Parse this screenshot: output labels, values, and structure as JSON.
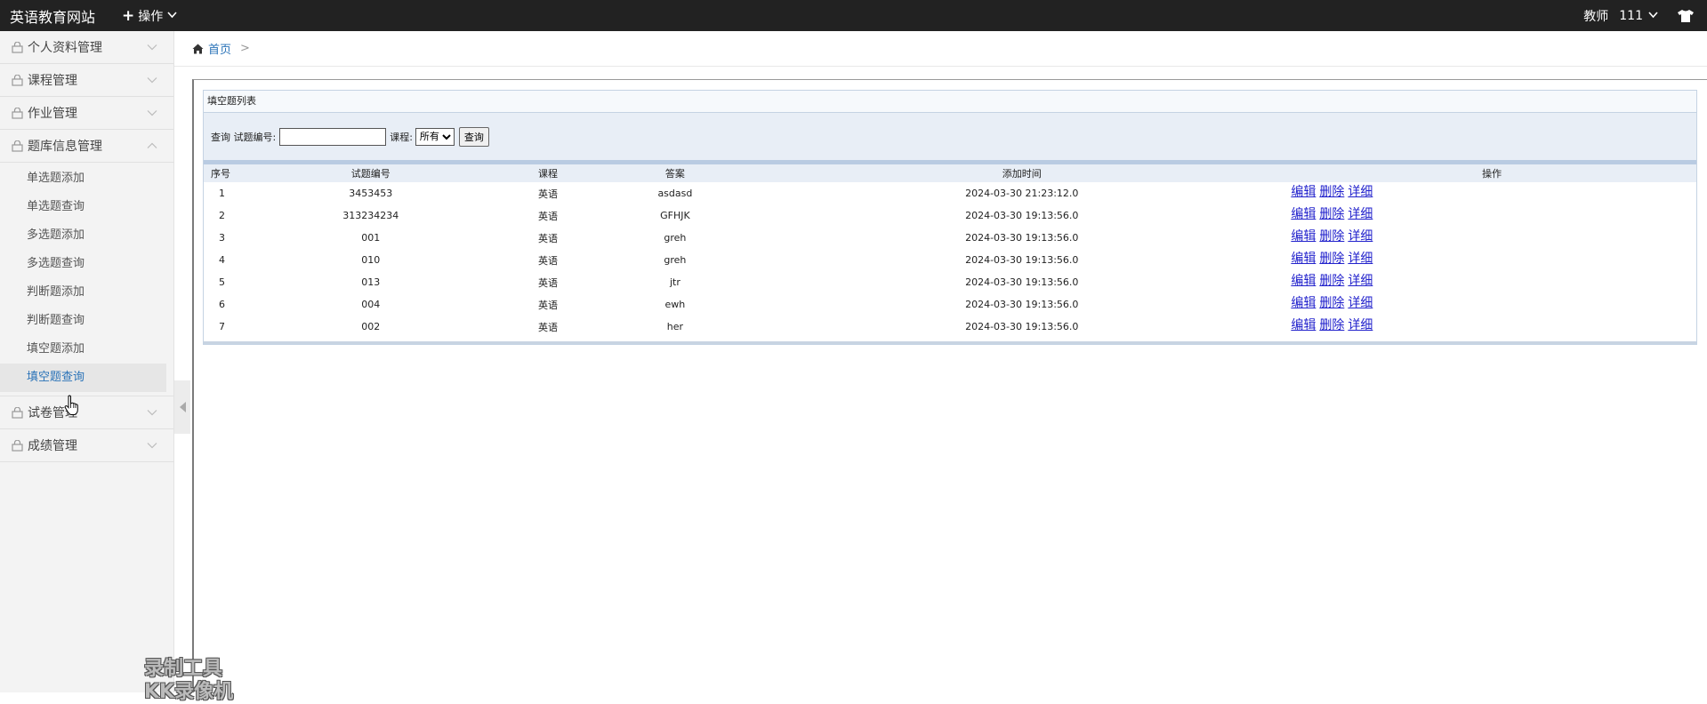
{
  "header": {
    "brand": "英语教育网站",
    "ops_label": "操作",
    "role": "教师",
    "username": "111"
  },
  "sidebar": {
    "groups": [
      {
        "label": "个人资料管理"
      },
      {
        "label": "课程管理"
      },
      {
        "label": "作业管理"
      },
      {
        "label": "题库信息管理"
      },
      {
        "label": "试卷管理"
      },
      {
        "label": "成绩管理"
      }
    ],
    "subitems": [
      "单选题添加",
      "单选题查询",
      "多选题添加",
      "多选题查询",
      "判断题添加",
      "判断题查询",
      "填空题添加",
      "填空题查询"
    ]
  },
  "breadcrumb": {
    "home": "首页",
    "sep": ">"
  },
  "panel": {
    "title": "填空题列表",
    "query_label": "查询 试题编号:",
    "course_label": "课程:",
    "course_selected": "所有",
    "search_button": "查询",
    "search_value": ""
  },
  "table": {
    "headers": [
      "序号",
      "试题编号",
      "课程",
      "答案",
      "添加时间",
      "操作"
    ],
    "rows": [
      {
        "idx": "1",
        "code": "3453453",
        "course": "英语",
        "answer": "asdasd",
        "time": "2024-03-30 21:23:12.0"
      },
      {
        "idx": "2",
        "code": "313234234",
        "course": "英语",
        "answer": "GFHJK",
        "time": "2024-03-30 19:13:56.0"
      },
      {
        "idx": "3",
        "code": "001",
        "course": "英语",
        "answer": "greh",
        "time": "2024-03-30 19:13:56.0"
      },
      {
        "idx": "4",
        "code": "010",
        "course": "英语",
        "answer": "greh",
        "time": "2024-03-30 19:13:56.0"
      },
      {
        "idx": "5",
        "code": "013",
        "course": "英语",
        "answer": "jtr",
        "time": "2024-03-30 19:13:56.0"
      },
      {
        "idx": "6",
        "code": "004",
        "course": "英语",
        "answer": "ewh",
        "time": "2024-03-30 19:13:56.0"
      },
      {
        "idx": "7",
        "code": "002",
        "course": "英语",
        "answer": "her",
        "time": "2024-03-30 19:13:56.0"
      }
    ],
    "op_edit": "编辑",
    "op_delete": "删除",
    "op_detail": "详细"
  },
  "watermark": {
    "line1": "录制工具",
    "line2": "KK录像机"
  }
}
